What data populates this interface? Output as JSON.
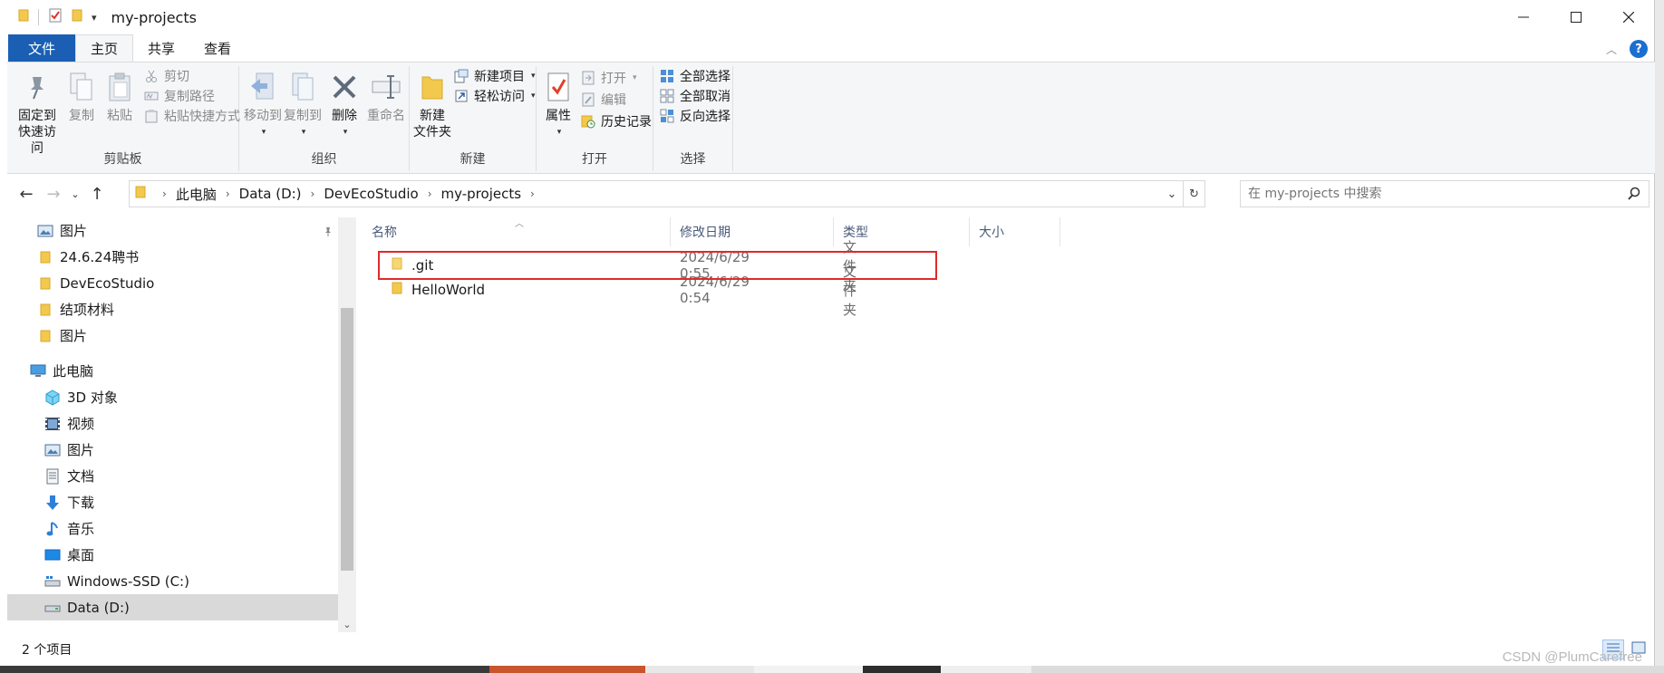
{
  "window": {
    "title": "my-projects"
  },
  "tabs": [
    {
      "label": "文件"
    },
    {
      "label": "主页"
    },
    {
      "label": "共享"
    },
    {
      "label": "查看"
    }
  ],
  "ribbon": {
    "clipboard": {
      "label": "剪贴板",
      "pin": "固定到\n快速访问",
      "pin_line1": "固定到",
      "pin_line2": "快速访问",
      "copy": "复制",
      "paste": "粘贴",
      "cut": "剪切",
      "copy_path": "复制路径",
      "paste_shortcut": "粘贴快捷方式"
    },
    "organize": {
      "label": "组织",
      "move_to": "移动到",
      "copy_to": "复制到",
      "delete": "删除",
      "rename": "重命名"
    },
    "new": {
      "label": "新建",
      "new_folder_line1": "新建",
      "new_folder_line2": "文件夹",
      "new_item": "新建项目",
      "easy_access": "轻松访问"
    },
    "open": {
      "label": "打开",
      "properties": "属性",
      "open": "打开",
      "edit": "编辑",
      "history": "历史记录"
    },
    "select": {
      "label": "选择",
      "select_all": "全部选择",
      "select_none": "全部取消",
      "invert": "反向选择"
    }
  },
  "address": {
    "crumbs": [
      "此电脑",
      "Data (D:)",
      "DevEcoStudio",
      "my-projects"
    ],
    "search_placeholder": "在 my-projects 中搜索"
  },
  "nav": {
    "items": [
      {
        "label": "图片",
        "icon": "pictures-icon"
      },
      {
        "label": "24.6.24聘书",
        "icon": "folder-icon"
      },
      {
        "label": "DevEcoStudio",
        "icon": "folder-icon"
      },
      {
        "label": "结项材料",
        "icon": "folder-icon"
      },
      {
        "label": "图片",
        "icon": "folder-icon"
      },
      {
        "label": "此电脑",
        "icon": "computer-icon"
      },
      {
        "label": "3D 对象",
        "icon": "3d-objects-icon"
      },
      {
        "label": "视频",
        "icon": "video-icon"
      },
      {
        "label": "图片",
        "icon": "pictures-icon"
      },
      {
        "label": "文档",
        "icon": "documents-icon"
      },
      {
        "label": "下载",
        "icon": "download-icon"
      },
      {
        "label": "音乐",
        "icon": "music-icon"
      },
      {
        "label": "桌面",
        "icon": "desktop-icon"
      },
      {
        "label": "Windows-SSD (C:)",
        "icon": "windows-drive-icon"
      },
      {
        "label": "Data (D:)",
        "icon": "drive-icon"
      }
    ]
  },
  "content": {
    "columns": {
      "name": "名称",
      "date": "修改日期",
      "type": "类型",
      "size": "大小"
    },
    "rows": [
      {
        "name": ".git",
        "date": "2024/6/29 0:55",
        "type": "文件夹",
        "size": ""
      },
      {
        "name": "HelloWorld",
        "date": "2024/6/29 0:54",
        "type": "文件夹",
        "size": ""
      }
    ]
  },
  "status": {
    "count": "2 个项目"
  },
  "watermark": "CSDN @PlumCarefree",
  "colors": {
    "file_tab": "#1a5fb4",
    "folder": "#f2c94c",
    "highlight": "#e02a2a",
    "accent_blue": "#1a6fd0"
  }
}
